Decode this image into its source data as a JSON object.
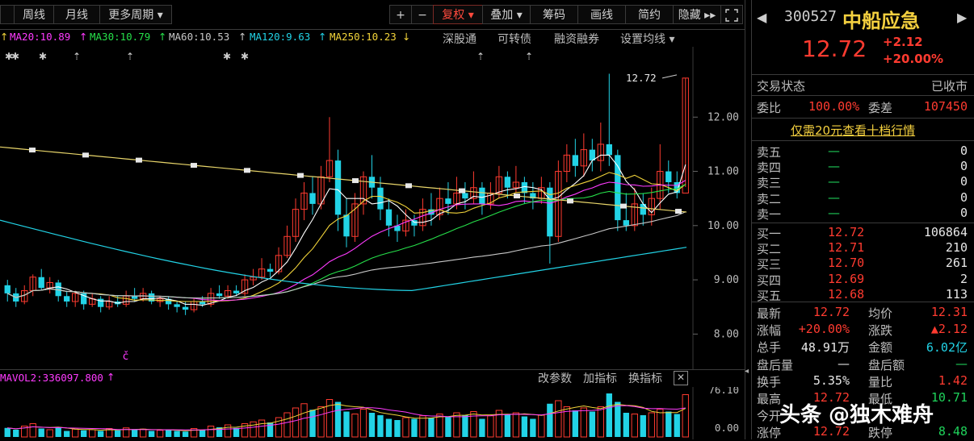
{
  "toolbar": {
    "items": [
      "周线",
      "月线",
      "更多周期 ▾",
      "+",
      "−",
      "复权 ▾",
      "叠加 ▾",
      "筹码",
      "画线",
      "简约",
      "隐藏 ▸▸"
    ],
    "fullscreen_icon": "expand-icon"
  },
  "ma_legend": [
    {
      "label": "MA20:10.89",
      "color": "#ff3bff"
    },
    {
      "label": "MA30:10.79",
      "color": "#26e04a"
    },
    {
      "label": "MA60:10.53",
      "color": "#c8c8c8"
    },
    {
      "label": "MA120:9.63",
      "color": "#22d3e6"
    },
    {
      "label": "MA250:10.23",
      "color": "#f2d43a"
    }
  ],
  "submenu": [
    "深股通",
    "可转债",
    "融资融券",
    "设置均线 ▾"
  ],
  "price_axis": [
    "12.00",
    "11.00",
    "10.00",
    "9.00",
    "8.00"
  ],
  "last_price_label": "12.72",
  "volume": {
    "label": "MAVOL2:336097.800",
    "buttons": [
      "改参数",
      "加指标",
      "换指标"
    ],
    "axis": [
      "76.10",
      "0.00"
    ]
  },
  "stock": {
    "code": "300527",
    "name": "中船应急",
    "price": "12.72",
    "change": "+2.12",
    "change_pct": "+20.00%"
  },
  "status": {
    "label": "交易状态",
    "value": "已收市"
  },
  "ratio": {
    "label1": "委比",
    "value1": "100.00%",
    "label2": "委差",
    "value2": "107450"
  },
  "level10_link": "仅需20元查看十档行情",
  "asks": [
    {
      "label": "卖五",
      "price": "—",
      "vol": "0"
    },
    {
      "label": "卖四",
      "price": "—",
      "vol": "0"
    },
    {
      "label": "卖三",
      "price": "—",
      "vol": "0"
    },
    {
      "label": "卖二",
      "price": "—",
      "vol": "0"
    },
    {
      "label": "卖一",
      "price": "—",
      "vol": "0"
    }
  ],
  "bids": [
    {
      "label": "买一",
      "price": "12.72",
      "vol": "106864"
    },
    {
      "label": "买二",
      "price": "12.71",
      "vol": "210"
    },
    {
      "label": "买三",
      "price": "12.70",
      "vol": "261"
    },
    {
      "label": "买四",
      "price": "12.69",
      "vol": "2"
    },
    {
      "label": "买五",
      "price": "12.68",
      "vol": "113"
    }
  ],
  "stats": [
    {
      "l1": "最新",
      "v1": "12.72",
      "l2": "均价",
      "v2": "12.31"
    },
    {
      "l1": "涨幅",
      "v1": "+20.00%",
      "l2": "涨跌",
      "v2": "▲2.12"
    },
    {
      "l1": "总手",
      "v1": "48.91万",
      "l2": "金额",
      "v2": "6.02亿"
    },
    {
      "l1": "盘后量",
      "v1": "—",
      "l2": "盘后额",
      "v2": "—"
    },
    {
      "l1": "换手",
      "v1": "5.35%",
      "l2": "量比",
      "v2": "1.42"
    },
    {
      "l1": "最高",
      "v1": "12.72",
      "l2": "最低",
      "v2": "10.71"
    },
    {
      "l1": "今开",
      "v1": "",
      "l2": "",
      "v2": ""
    },
    {
      "l1": "涨停",
      "v1": "12.72",
      "l2": "跌停",
      "v2": "8.48"
    }
  ],
  "watermark": "头条 @独木难舟",
  "chart_data": {
    "type": "candlestick",
    "y_range": [
      7.5,
      13.0
    ],
    "candles": [
      [
        8.9,
        8.75,
        9.0,
        8.6
      ],
      [
        8.75,
        8.6,
        8.85,
        8.5
      ],
      [
        8.6,
        8.8,
        8.9,
        8.55
      ],
      [
        8.8,
        9.05,
        9.1,
        8.7
      ],
      [
        9.05,
        8.85,
        9.2,
        8.8
      ],
      [
        8.85,
        8.95,
        9.05,
        8.75
      ],
      [
        8.95,
        8.7,
        9.0,
        8.6
      ],
      [
        8.7,
        8.6,
        8.8,
        8.5
      ],
      [
        8.6,
        8.75,
        8.8,
        8.5
      ],
      [
        8.75,
        8.55,
        8.8,
        8.45
      ],
      [
        8.55,
        8.65,
        8.75,
        8.5
      ],
      [
        8.65,
        8.5,
        8.7,
        8.4
      ],
      [
        8.5,
        8.6,
        8.7,
        8.45
      ],
      [
        8.6,
        8.55,
        8.7,
        8.5
      ],
      [
        8.55,
        8.7,
        8.8,
        8.5
      ],
      [
        8.7,
        8.65,
        8.85,
        8.6
      ],
      [
        8.65,
        8.75,
        8.85,
        8.6
      ],
      [
        8.75,
        8.6,
        8.8,
        8.55
      ],
      [
        8.6,
        8.65,
        8.7,
        8.5
      ],
      [
        8.65,
        8.55,
        8.7,
        8.45
      ],
      [
        8.55,
        8.5,
        8.6,
        8.4
      ],
      [
        8.5,
        8.45,
        8.6,
        8.35
      ],
      [
        8.45,
        8.6,
        8.65,
        8.4
      ],
      [
        8.6,
        8.55,
        8.7,
        8.5
      ],
      [
        8.55,
        8.75,
        8.85,
        8.5
      ],
      [
        8.75,
        8.7,
        8.9,
        8.65
      ],
      [
        8.7,
        8.8,
        8.9,
        8.65
      ],
      [
        8.8,
        8.75,
        8.9,
        8.7
      ],
      [
        8.75,
        9.0,
        9.1,
        8.7
      ],
      [
        9.0,
        9.05,
        9.2,
        8.9
      ],
      [
        9.05,
        9.2,
        9.4,
        9.0
      ],
      [
        9.2,
        9.15,
        9.3,
        9.05
      ],
      [
        9.15,
        9.45,
        9.6,
        9.1
      ],
      [
        9.45,
        9.8,
        10.0,
        9.4
      ],
      [
        9.8,
        10.3,
        10.5,
        9.7
      ],
      [
        10.3,
        10.6,
        10.8,
        10.1
      ],
      [
        10.6,
        10.4,
        10.9,
        10.2
      ],
      [
        10.4,
        10.9,
        11.1,
        10.3
      ],
      [
        10.9,
        11.2,
        12.0,
        10.8
      ],
      [
        11.2,
        10.2,
        11.4,
        9.9
      ],
      [
        10.2,
        9.8,
        10.5,
        9.6
      ],
      [
        9.8,
        10.4,
        10.6,
        9.7
      ],
      [
        10.4,
        10.9,
        11.0,
        10.2
      ],
      [
        10.9,
        10.7,
        11.3,
        10.5
      ],
      [
        10.7,
        10.3,
        10.9,
        10.1
      ],
      [
        10.3,
        10.0,
        10.5,
        9.8
      ],
      [
        10.0,
        9.9,
        10.2,
        9.7
      ],
      [
        9.9,
        10.1,
        10.3,
        9.8
      ],
      [
        10.1,
        10.0,
        10.2,
        9.8
      ],
      [
        10.0,
        10.3,
        10.5,
        9.9
      ],
      [
        10.3,
        10.2,
        10.6,
        10.0
      ],
      [
        10.2,
        10.5,
        10.7,
        10.1
      ],
      [
        10.5,
        10.4,
        10.8,
        10.2
      ],
      [
        10.4,
        10.6,
        10.9,
        10.3
      ],
      [
        10.6,
        10.5,
        10.8,
        10.3
      ],
      [
        10.5,
        10.7,
        11.0,
        10.4
      ],
      [
        10.7,
        10.4,
        10.8,
        10.2
      ],
      [
        10.4,
        10.6,
        10.8,
        10.3
      ],
      [
        10.6,
        10.9,
        11.1,
        10.5
      ],
      [
        10.9,
        10.7,
        11.0,
        10.5
      ],
      [
        10.7,
        10.8,
        11.1,
        10.6
      ],
      [
        10.8,
        10.6,
        10.9,
        10.4
      ],
      [
        10.6,
        10.5,
        10.8,
        10.3
      ],
      [
        10.5,
        10.7,
        10.9,
        10.4
      ],
      [
        10.7,
        9.8,
        10.8,
        9.3
      ],
      [
        9.8,
        11.0,
        11.2,
        9.7
      ],
      [
        11.0,
        11.3,
        11.5,
        10.8
      ],
      [
        11.3,
        11.1,
        11.6,
        10.9
      ],
      [
        11.1,
        11.4,
        11.7,
        10.9
      ],
      [
        11.4,
        11.2,
        11.6,
        11.0
      ],
      [
        11.2,
        11.5,
        11.9,
        11.0
      ],
      [
        11.5,
        11.3,
        12.8,
        11.1
      ],
      [
        11.3,
        10.1,
        11.4,
        9.9
      ],
      [
        10.1,
        10.0,
        10.6,
        9.9
      ],
      [
        10.0,
        10.4,
        10.7,
        9.9
      ],
      [
        10.4,
        10.2,
        10.6,
        10.0
      ],
      [
        10.2,
        10.5,
        10.7,
        10.0
      ],
      [
        10.5,
        11.0,
        11.5,
        10.3
      ],
      [
        11.0,
        10.8,
        11.2,
        10.6
      ],
      [
        10.8,
        10.6,
        11.0,
        10.5
      ],
      [
        10.6,
        12.72,
        12.72,
        10.71
      ]
    ],
    "volumes": [
      15,
      12,
      18,
      22,
      14,
      12,
      16,
      10,
      13,
      11,
      12,
      10,
      14,
      11,
      15,
      12,
      13,
      10,
      11,
      12,
      10,
      9,
      14,
      12,
      18,
      16,
      20,
      15,
      22,
      25,
      28,
      24,
      32,
      40,
      48,
      55,
      45,
      50,
      62,
      58,
      42,
      38,
      46,
      40,
      36,
      30,
      28,
      32,
      30,
      35,
      32,
      38,
      34,
      40,
      36,
      42,
      30,
      35,
      44,
      38,
      40,
      34,
      30,
      36,
      55,
      60,
      50,
      44,
      48,
      42,
      50,
      72,
      58,
      40,
      38,
      36,
      40,
      46,
      42,
      38,
      70
    ]
  }
}
